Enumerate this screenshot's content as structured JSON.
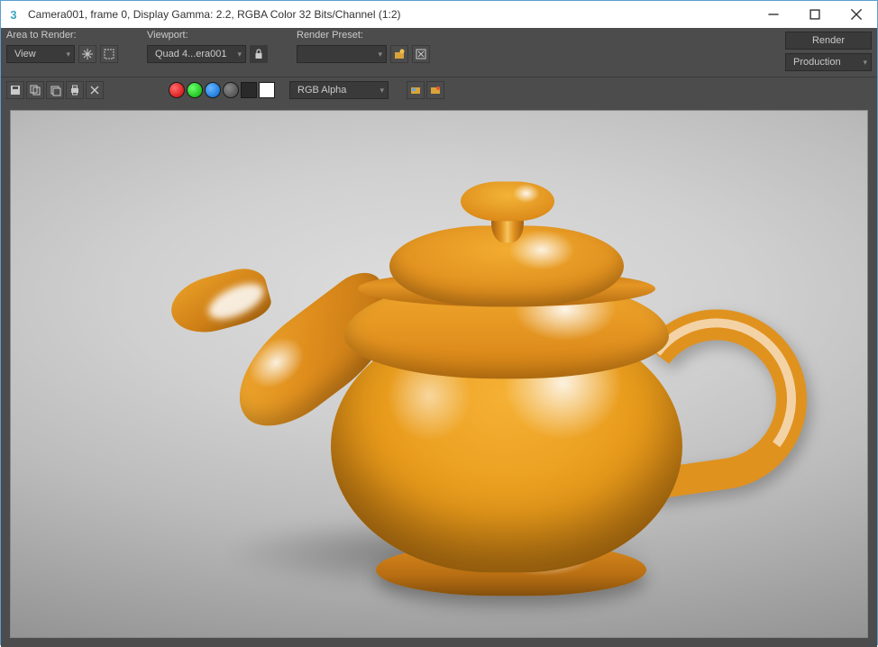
{
  "title_bar": {
    "title": "Camera001, frame 0, Display Gamma: 2.2, RGBA Color 32 Bits/Channel (1:2)"
  },
  "toolbar": {
    "area_to_render_label": "Area to Render:",
    "area_to_render_value": "View",
    "viewport_label": "Viewport:",
    "viewport_value": "Quad 4...era001",
    "render_preset_label": "Render Preset:",
    "render_preset_value": "",
    "render_button": "Render",
    "production_value": "Production"
  },
  "channel": {
    "value": "RGB Alpha"
  },
  "icons": {
    "save": "save-icon",
    "copy": "copy-icon",
    "clone": "clone-icon",
    "print": "print-icon",
    "delete": "delete-icon",
    "pan": "pan-icon",
    "region": "region-icon",
    "lock": "lock-icon",
    "preset_a": "preset-load-icon",
    "preset_b": "preset-save-icon",
    "toggle_a": "overlay-a-icon",
    "toggle_b": "overlay-b-icon"
  },
  "colors": {
    "red": "#cc0000",
    "green": "#00aa00",
    "blue": "#0066cc",
    "accent_teapot": "#e89a1a"
  }
}
